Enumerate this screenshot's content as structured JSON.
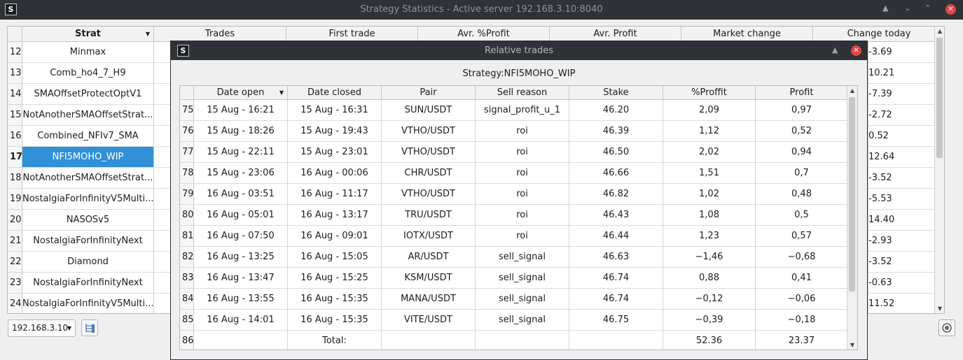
{
  "window": {
    "title": "Strategy Statistics - Active server 192.168.3.10:8040",
    "icon": "S"
  },
  "main_table": {
    "columns": [
      "Strat",
      "Trades",
      "First trade",
      "Avr. %Profit",
      "Avr. Profit",
      "Market change",
      "Change today"
    ],
    "rows": [
      {
        "num": "12",
        "strat": "Minmax",
        "change_today": "-3.69"
      },
      {
        "num": "13",
        "strat": "Comb_ho4_7_H9",
        "change_today": "10.21"
      },
      {
        "num": "14",
        "strat": "SMAOffsetProtectOptV1",
        "change_today": "-7.39"
      },
      {
        "num": "15",
        "strat": "NotAnotherSMAOffsetStrat...",
        "change_today": "-2.72"
      },
      {
        "num": "16",
        "strat": "Combined_NFIv7_SMA",
        "change_today": "0.52"
      },
      {
        "num": "17",
        "strat": "NFI5MOHO_WIP",
        "change_today": "12.64",
        "selected": true
      },
      {
        "num": "18",
        "strat": "NotAnotherSMAOffsetStrat...",
        "change_today": "-3.52"
      },
      {
        "num": "19",
        "strat": "NostalgiaForInfinityV5Multi...",
        "change_today": "-5.53"
      },
      {
        "num": "20",
        "strat": "NASOSv5",
        "change_today": "14.40"
      },
      {
        "num": "21",
        "strat": "NostalgiaForInfinityNext",
        "change_today": "-2.93"
      },
      {
        "num": "22",
        "strat": "Diamond",
        "change_today": "-3.52"
      },
      {
        "num": "23",
        "strat": "NostalgiaForInfinityNext",
        "change_today": "-0.63"
      },
      {
        "num": "24",
        "strat": "NostalgiaForInfinityV5Multi...",
        "change_today": "11.52"
      }
    ]
  },
  "server_combo": {
    "value": "192.168.3.10"
  },
  "dialog": {
    "title": "Relative trades",
    "icon": "S",
    "strategy_label": "Strategy:NFI5MOHO_WIP",
    "columns": [
      "Date open",
      "Date closed",
      "Pair",
      "Sell reason",
      "Stake",
      "%Proffit",
      "Profit"
    ],
    "rows": [
      {
        "num": "75",
        "cells": [
          "15 Aug - 16:21",
          "15 Aug - 16:31",
          "SUN/USDT",
          "signal_profit_u_1",
          "46.20",
          "2,09",
          "0,97"
        ]
      },
      {
        "num": "76",
        "cells": [
          "15 Aug - 18:26",
          "15 Aug - 19:43",
          "VTHO/USDT",
          "roi",
          "46.39",
          "1,12",
          "0,52"
        ]
      },
      {
        "num": "77",
        "cells": [
          "15 Aug - 22:11",
          "15 Aug - 23:01",
          "VTHO/USDT",
          "roi",
          "46.50",
          "2,02",
          "0,94"
        ]
      },
      {
        "num": "78",
        "cells": [
          "15 Aug - 23:06",
          "16 Aug - 00:06",
          "CHR/USDT",
          "roi",
          "46.66",
          "1,51",
          "0,7"
        ]
      },
      {
        "num": "79",
        "cells": [
          "16 Aug - 03:51",
          "16 Aug - 11:17",
          "VTHO/USDT",
          "roi",
          "46.82",
          "1,02",
          "0,48"
        ]
      },
      {
        "num": "80",
        "cells": [
          "16 Aug - 05:01",
          "16 Aug - 13:17",
          "TRU/USDT",
          "roi",
          "46.43",
          "1,08",
          "0,5"
        ]
      },
      {
        "num": "81",
        "cells": [
          "16 Aug - 07:50",
          "16 Aug - 09:01",
          "IOTX/USDT",
          "roi",
          "46.44",
          "1,23",
          "0,57"
        ]
      },
      {
        "num": "82",
        "cells": [
          "16 Aug - 13:25",
          "16 Aug - 15:05",
          "AR/USDT",
          "sell_signal",
          "46.63",
          "−1,46",
          "−0,68"
        ]
      },
      {
        "num": "83",
        "cells": [
          "16 Aug - 13:47",
          "16 Aug - 15:25",
          "KSM/USDT",
          "sell_signal",
          "46.74",
          "0,88",
          "0,41"
        ]
      },
      {
        "num": "84",
        "cells": [
          "16 Aug - 13:55",
          "16 Aug - 15:35",
          "MANA/USDT",
          "sell_signal",
          "46.74",
          "−0,12",
          "−0,06"
        ]
      },
      {
        "num": "85",
        "cells": [
          "16 Aug - 14:01",
          "16 Aug - 15:35",
          "VITE/USDT",
          "sell_signal",
          "46.75",
          "−0,39",
          "−0,18"
        ]
      },
      {
        "num": "86",
        "cells": [
          "",
          "Total:",
          "",
          "",
          "",
          "52.36",
          "23.37"
        ]
      }
    ]
  },
  "icons": {
    "sort": "sort-down-icon",
    "shade": "shade-icon",
    "close": "close-icon",
    "tree": "tree-icon",
    "camera": "camera-icon"
  }
}
